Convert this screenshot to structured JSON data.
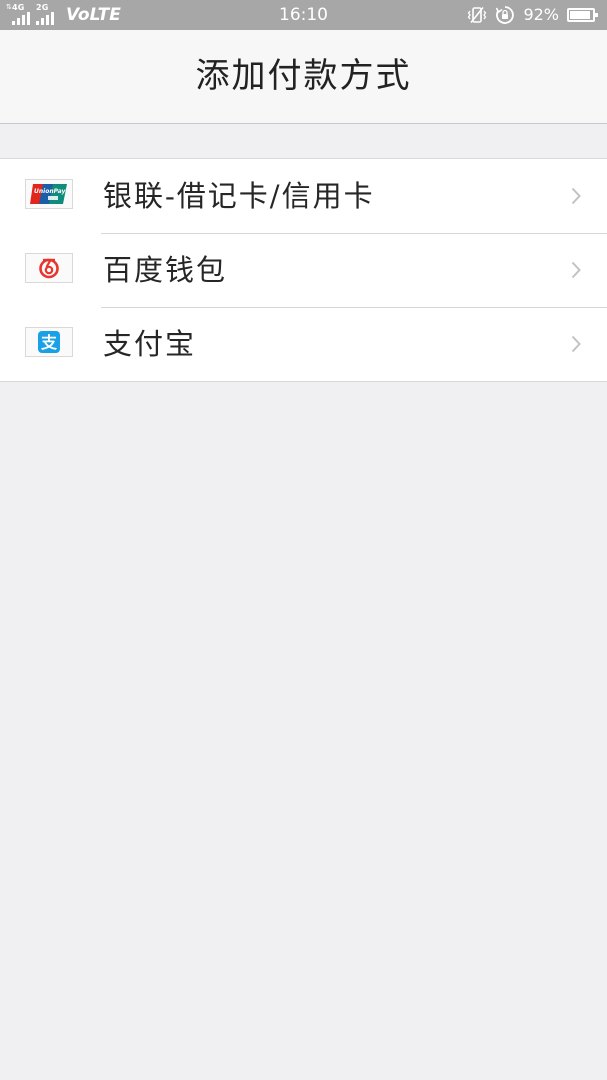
{
  "status_bar": {
    "net1": "4G",
    "net2": "2G",
    "volte": "VoLTE",
    "time": "16:10",
    "battery_percent": "92%",
    "battery_level": 0.92,
    "icons": [
      "vibrate-icon",
      "rotation-lock-icon",
      "battery-icon"
    ]
  },
  "header": {
    "title": "添加付款方式"
  },
  "payment_methods": [
    {
      "label": "银联-借记卡/信用卡",
      "icon": "unionpay-icon",
      "icon_text": "UnionPay"
    },
    {
      "label": "百度钱包",
      "icon": "baidu-wallet-icon"
    },
    {
      "label": "支付宝",
      "icon": "alipay-icon",
      "icon_glyph": "支"
    }
  ],
  "colors": {
    "status_bar_bg": "#a7a7a7",
    "page_bg": "#f0f0f2",
    "unionpay_red": "#e2261b",
    "unionpay_blue": "#1a5ea8",
    "unionpay_green": "#0f8c7c",
    "baidu_red": "#e8352d",
    "alipay_blue": "#1aa0e6",
    "chevron": "#c2c2c2"
  }
}
